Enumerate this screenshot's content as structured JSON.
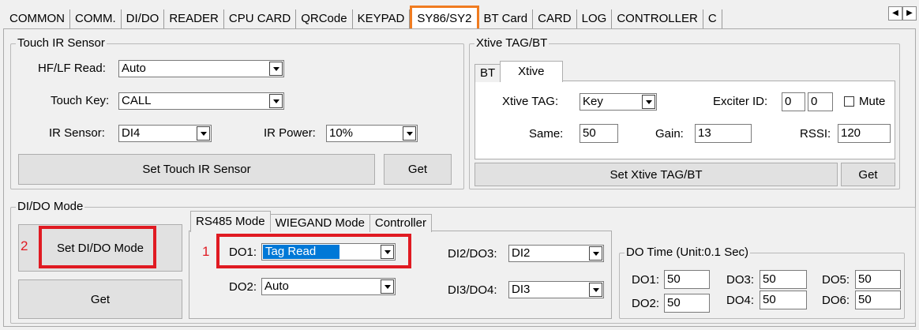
{
  "tabs": [
    "COMMON",
    "COMM.",
    "DI/DO",
    "READER",
    "CPU CARD",
    "QRCode",
    "KEYPAD",
    "SY86/SY2",
    "BT Card",
    "CARD",
    "LOG",
    "CONTROLLER",
    "C"
  ],
  "active_tab": "SY86/SY2",
  "touch_ir": {
    "title": "Touch IR Sensor",
    "hf_lf_label": "HF/LF Read:",
    "hf_lf_value": "Auto",
    "touch_key_label": "Touch Key:",
    "touch_key_value": "CALL",
    "ir_sensor_label": "IR Sensor:",
    "ir_sensor_value": "DI4",
    "ir_power_label": "IR Power:",
    "ir_power_value": "10%",
    "set_button": "Set Touch IR Sensor",
    "get_button": "Get"
  },
  "xtive": {
    "title": "Xtive TAG/BT",
    "tab_bt": "BT",
    "tab_xtive": "Xtive",
    "tag_label": "Xtive TAG:",
    "tag_value": "Key",
    "exciter_label": "Exciter ID:",
    "exciter_1": "0",
    "exciter_2": "0",
    "mute_label": "Mute",
    "same_label": "Same:",
    "same_value": "50",
    "gain_label": "Gain:",
    "gain_value": "13",
    "rssi_label": "RSSI:",
    "rssi_value": "120",
    "set_button": "Set Xtive TAG/BT",
    "get_button": "Get"
  },
  "dido": {
    "title": "DI/DO Mode",
    "set_button": "Set DI/DO Mode",
    "get_button": "Get",
    "callout_2": "2",
    "callout_1": "1",
    "tab_rs485": "RS485 Mode",
    "tab_wiegand": "WIEGAND Mode",
    "tab_controller": "Controller",
    "do1_label": "DO1:",
    "do1_value": "Tag Read",
    "do2_label": "DO2:",
    "do2_value": "Auto",
    "di2do3_label": "DI2/DO3:",
    "di2do3_value": "DI2",
    "di3do4_label": "DI3/DO4:",
    "di3do4_value": "DI3"
  },
  "do_time": {
    "title": "DO Time (Unit:0.1 Sec)",
    "do1_label": "DO1:",
    "do1_value": "50",
    "do2_label": "DO2:",
    "do2_value": "50",
    "do3_label": "DO3:",
    "do3_value": "50",
    "do4_label": "DO4:",
    "do4_value": "50",
    "do5_label": "DO5:",
    "do5_value": "50",
    "do6_label": "DO6:",
    "do6_value": "50"
  },
  "colors": {
    "highlight_tab_border": "#f07c20",
    "annotation_red": "#e01a22",
    "selection_blue": "#0078d7"
  }
}
